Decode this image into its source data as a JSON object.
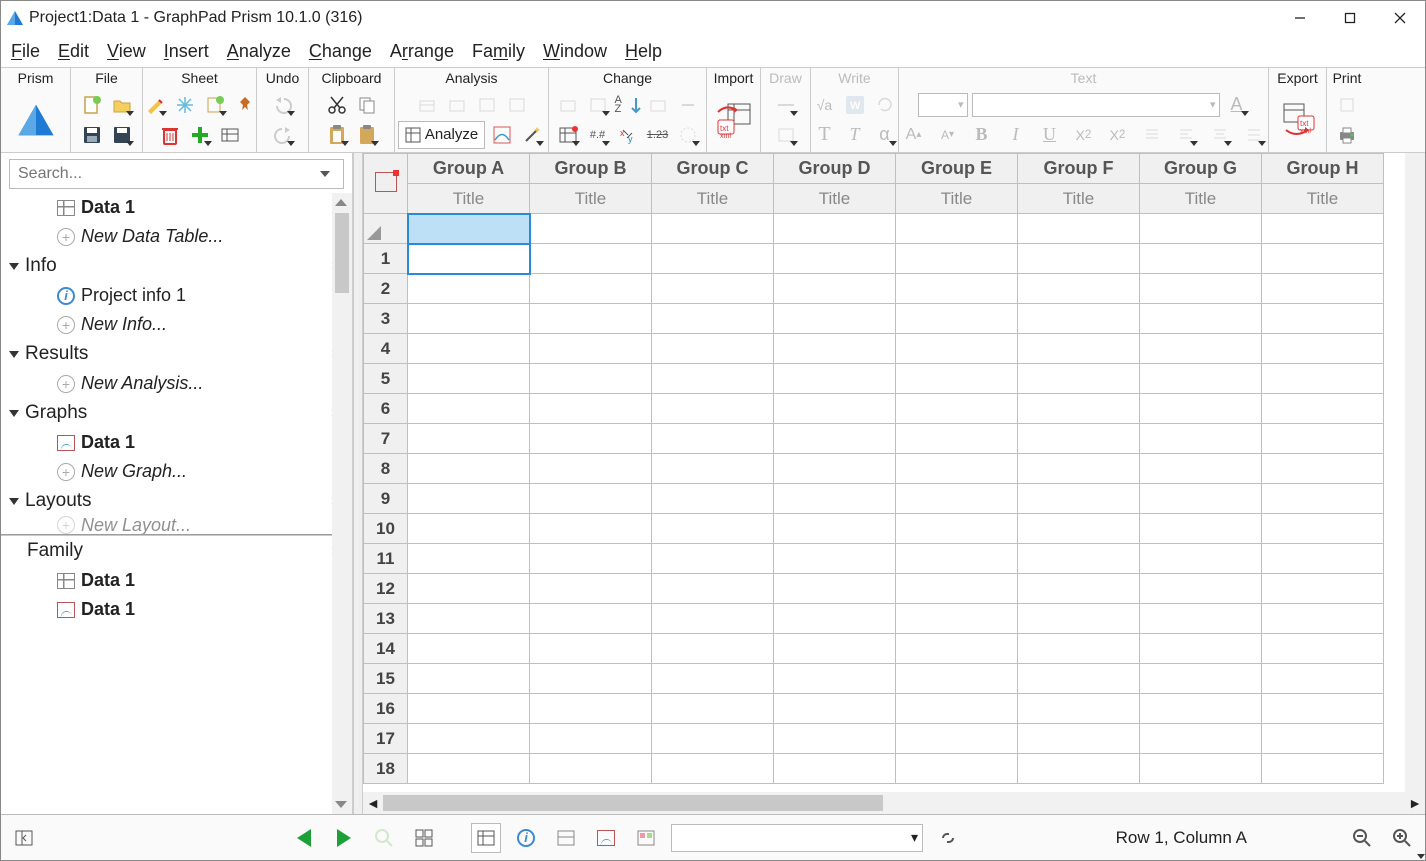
{
  "window": {
    "title": "Project1:Data 1 - GraphPad Prism 10.1.0 (316)"
  },
  "menu": {
    "file": "File",
    "edit": "Edit",
    "view": "View",
    "insert": "Insert",
    "analyze": "Analyze",
    "change": "Change",
    "arrange": "Arrange",
    "family": "Family",
    "window": "Window",
    "help": "Help"
  },
  "ribbon": {
    "prism": "Prism",
    "file": "File",
    "sheet": "Sheet",
    "undo": "Undo",
    "clipboard": "Clipboard",
    "analysis": "Analysis",
    "analyze_btn": "Analyze",
    "change": "Change",
    "import": "Import",
    "draw": "Draw",
    "write": "Write",
    "text": "Text",
    "export": "Export",
    "print": "Print",
    "numfmt": "#.#",
    "sqrt": "√a",
    "t_icon": "T",
    "bold": "B",
    "italic": "I",
    "underline": "U",
    "subA1": "A",
    "subA2": "A",
    "sup": "X",
    "sub": "X",
    "e2": "2",
    "numstr": "1.23",
    "az": "A\nZ"
  },
  "nav": {
    "search_placeholder": "Search...",
    "data1": "Data 1",
    "new_data": "New Data Table...",
    "info": "Info",
    "projectinfo": "Project info 1",
    "newinfo": "New Info...",
    "results": "Results",
    "newanalysis": "New Analysis...",
    "graphs": "Graphs",
    "data1g": "Data 1",
    "newgraph": "New Graph...",
    "layouts": "Layouts",
    "newlayout": "New Layout...",
    "family": "Family",
    "fam_d1": "Data 1",
    "fam_g1": "Data 1"
  },
  "grid": {
    "groups": [
      "Group A",
      "Group B",
      "Group C",
      "Group D",
      "Group E",
      "Group F",
      "Group G",
      "Group H"
    ],
    "title": "Title",
    "rows": [
      "1",
      "2",
      "3",
      "4",
      "5",
      "6",
      "7",
      "8",
      "9",
      "10",
      "11",
      "12",
      "13",
      "14",
      "15",
      "16",
      "17",
      "18"
    ]
  },
  "status": {
    "pos": "Row 1, Column A"
  }
}
